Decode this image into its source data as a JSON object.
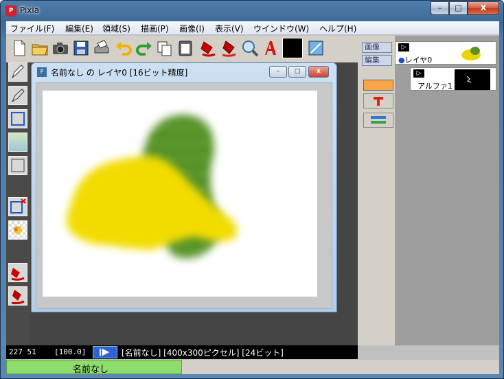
{
  "window": {
    "title": "Pixia",
    "min_glyph": "–",
    "max_glyph": "□",
    "close_glyph": "X"
  },
  "menu": [
    "ファイル(F)",
    "編集(E)",
    "領域(S)",
    "描画(P)",
    "画像(I)",
    "表示(V)",
    "ウインドウ(W)",
    "ヘルプ(H)"
  ],
  "toolbar": {
    "icons": [
      "new-file-icon",
      "open-folder-icon",
      "camera-icon",
      "save-icon",
      "print-icon",
      "undo-icon",
      "redo-icon",
      "copy-icon",
      "paste-icon",
      "fill-bucket-icon",
      "fill-bucket-2-icon",
      "magnifier-icon",
      "text-tool-icon",
      "color-black-icon",
      "transform-icon"
    ],
    "current_color": "#000000"
  },
  "document": {
    "title": "名前なし の レイヤ0 [16ビット精度]",
    "min_glyph": "–",
    "max_glyph": "□",
    "close_glyph": "x"
  },
  "right_panel": {
    "tab_image": "画像",
    "tab_edit": "編集",
    "color": "#f8a548",
    "layers": [
      {
        "name": "レイヤ0",
        "visible_glyph": "▷"
      },
      {
        "name": "アルファ1",
        "visible_glyph": "▷"
      }
    ]
  },
  "status": {
    "coords": "227 51",
    "zoom": "[100.0]",
    "info": "[名前なし] [400x300ピクセル] [24ビット]"
  },
  "doc_tab": {
    "label": "名前なし"
  },
  "colors": {
    "accent": "#2d63d8",
    "tab_green": "#8edc6b",
    "paint_yellow": "#f2dc00",
    "leaf_green": "#4e8a23"
  }
}
